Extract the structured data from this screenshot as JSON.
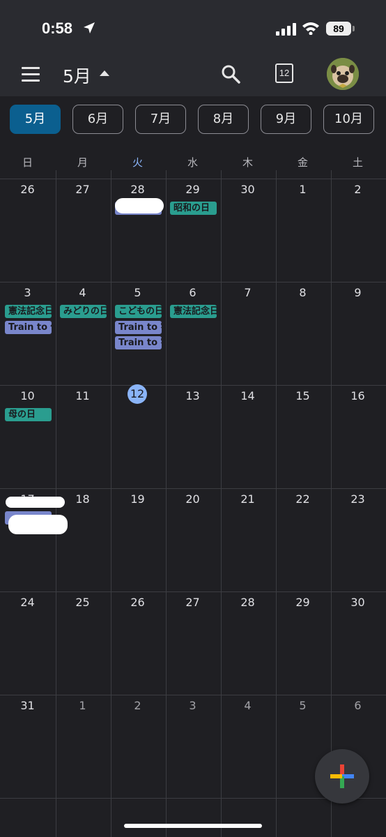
{
  "status_bar": {
    "time": "0:58",
    "battery": "89"
  },
  "header": {
    "month_title": "5月",
    "today_number": "12"
  },
  "month_chips": [
    {
      "label": "5月",
      "active": true
    },
    {
      "label": "6月",
      "active": false
    },
    {
      "label": "7月",
      "active": false
    },
    {
      "label": "8月",
      "active": false
    },
    {
      "label": "9月",
      "active": false
    },
    {
      "label": "10月",
      "active": false
    }
  ],
  "weekdays": [
    "日",
    "月",
    "火",
    "水",
    "木",
    "金",
    "土"
  ],
  "today_weekday_index": 2,
  "weeks": [
    [
      {
        "d": "26"
      },
      {
        "d": "27"
      },
      {
        "d": "28"
      },
      {
        "d": "29"
      },
      {
        "d": "30"
      },
      {
        "d": "1"
      },
      {
        "d": "2"
      }
    ],
    [
      {
        "d": "3"
      },
      {
        "d": "4"
      },
      {
        "d": "5"
      },
      {
        "d": "6"
      },
      {
        "d": "7"
      },
      {
        "d": "8"
      },
      {
        "d": "9"
      }
    ],
    [
      {
        "d": "10"
      },
      {
        "d": "11"
      },
      {
        "d": "12",
        "today": true
      },
      {
        "d": "13"
      },
      {
        "d": "14"
      },
      {
        "d": "15"
      },
      {
        "d": "16"
      }
    ],
    [
      {
        "d": "17"
      },
      {
        "d": "18"
      },
      {
        "d": "19"
      },
      {
        "d": "20"
      },
      {
        "d": "21"
      },
      {
        "d": "22"
      },
      {
        "d": "23"
      }
    ],
    [
      {
        "d": "24"
      },
      {
        "d": "25"
      },
      {
        "d": "26"
      },
      {
        "d": "27"
      },
      {
        "d": "28"
      },
      {
        "d": "29"
      },
      {
        "d": "30"
      }
    ],
    [
      {
        "d": "31"
      },
      {
        "d": "1",
        "other": true
      },
      {
        "d": "2",
        "other": true
      },
      {
        "d": "3",
        "other": true
      },
      {
        "d": "4",
        "other": true
      },
      {
        "d": "5",
        "other": true
      },
      {
        "d": "6",
        "other": true
      }
    ]
  ],
  "events": [
    {
      "week": 0,
      "day": 2,
      "slot": 0,
      "label": "",
      "color": "purple"
    },
    {
      "week": 0,
      "day": 3,
      "slot": 0,
      "label": "昭和の日",
      "color": "teal"
    },
    {
      "week": 1,
      "day": 0,
      "slot": 0,
      "label": "憲法記念日",
      "color": "teal"
    },
    {
      "week": 1,
      "day": 0,
      "slot": 1,
      "label": "Train to 佐",
      "color": "purple"
    },
    {
      "week": 1,
      "day": 1,
      "slot": 0,
      "label": "みどりの日",
      "color": "teal"
    },
    {
      "week": 1,
      "day": 2,
      "slot": 0,
      "label": "こどもの日",
      "color": "teal"
    },
    {
      "week": 1,
      "day": 2,
      "slot": 1,
      "label": "Train to 宇",
      "color": "purple"
    },
    {
      "week": 1,
      "day": 2,
      "slot": 2,
      "label": "Train to 宇",
      "color": "purple"
    },
    {
      "week": 1,
      "day": 3,
      "slot": 0,
      "label": "憲法記念日",
      "color": "teal"
    },
    {
      "week": 2,
      "day": 0,
      "slot": 0,
      "label": "母の日",
      "color": "teal"
    },
    {
      "week": 3,
      "day": 0,
      "slot": 0,
      "label": "",
      "color": "purple"
    }
  ],
  "colors": {
    "teal": "#2a9d8f",
    "purple": "#7986cb",
    "accent": "#8ab4f8",
    "chip_active": "#0b5f8f"
  }
}
